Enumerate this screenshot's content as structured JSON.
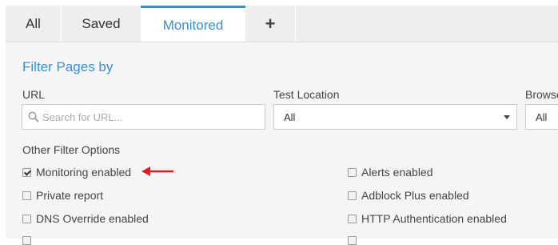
{
  "tabs": [
    {
      "label": "All"
    },
    {
      "label": "Saved"
    },
    {
      "label": "Monitored",
      "active": true
    },
    {
      "label": "+"
    }
  ],
  "panel": {
    "title": "Filter Pages by",
    "url": {
      "label": "URL",
      "placeholder": "Search for URL..."
    },
    "test_location": {
      "label": "Test Location",
      "value": "All"
    },
    "browser": {
      "label": "Browser",
      "value": "All"
    },
    "other_label": "Other Filter Options",
    "options": [
      {
        "label": "Monitoring enabled",
        "checked": true
      },
      {
        "label": "Alerts enabled",
        "checked": false
      },
      {
        "label": "Private report",
        "checked": false
      },
      {
        "label": "Adblock Plus enabled",
        "checked": false
      },
      {
        "label": "DNS Override enabled",
        "checked": false
      },
      {
        "label": "HTTP Authentication enabled",
        "checked": false
      }
    ]
  },
  "colors": {
    "accent": "#3a8fcf",
    "arrow": "#e0201f",
    "panel_bg": "#f5f5f5",
    "tab_bg": "#eeeeee"
  },
  "icons": {
    "search": "search-icon",
    "arrow": "red-arrow-icon",
    "caret": "chevron-down-icon"
  }
}
